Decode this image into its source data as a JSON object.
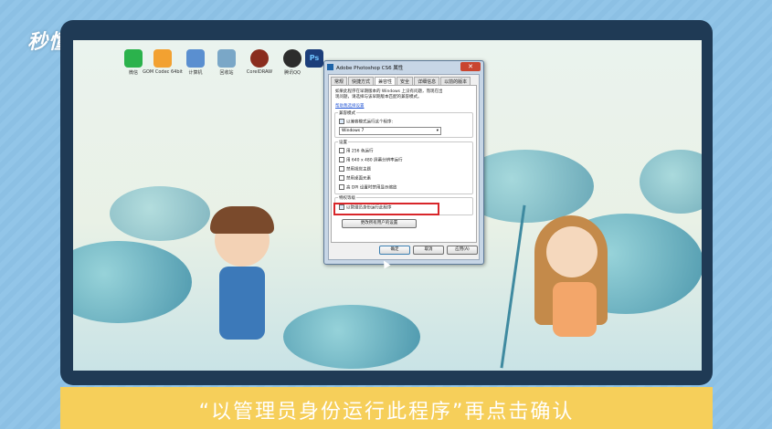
{
  "brand": {
    "logo_text": "秒懂视频"
  },
  "desktop_icons": [
    {
      "label": "微信",
      "color": "#2bb24c"
    },
    {
      "label": "GOM Codec 64bit",
      "color": "#f2a131"
    },
    {
      "label": "计算机",
      "color": "#5a8fd0"
    },
    {
      "label": "回收站",
      "color": "#7aa7c7"
    },
    {
      "label": "CorelDRAW",
      "color": "#8a2d1e"
    },
    {
      "label": "腾讯QQ",
      "color": "#2c2c2c"
    },
    {
      "label": "Ps",
      "color": "#1c3e7a"
    }
  ],
  "dialog": {
    "title": "Adobe Photoshop CS6 属性",
    "close_label": "✕",
    "tabs": [
      "常规",
      "快捷方式",
      "兼容性",
      "安全",
      "详细信息",
      "以前的版本"
    ],
    "active_tab": "兼容性",
    "intro_text_line1": "如果此程序在早期版本的 Windows 上没有问题，而现在出",
    "intro_text_line2": "现问题，请选择与该早期版本匹配的兼容模式。",
    "help_link": "帮助我选择设置",
    "compat_mode": {
      "group_label": "兼容模式",
      "checkbox_label": "以兼容模式运行这个程序:",
      "checked": true,
      "selected_os": "Windows 7"
    },
    "settings": {
      "group_label": "设置",
      "items": [
        "用 256 色运行",
        "用 640 x 480 屏幕分辨率运行",
        "禁用视觉主题",
        "禁用桌面元素",
        "高 DPI 设置时禁用显示缩放"
      ]
    },
    "privilege": {
      "group_label": "特权等级",
      "checkbox_label": "以管理员身份运行此程序",
      "checked": true
    },
    "change_all_users_button": "更改所有用户的设置",
    "ok_button": "确定",
    "cancel_button": "取消",
    "apply_button": "应用(A)"
  },
  "caption": {
    "text": "“以管理员身份运行此程序”再点击确认"
  },
  "colors": {
    "highlight": "#d8262a",
    "caption_bg": "#f6cf5a",
    "monitor_bezel": "#1f3a55"
  }
}
